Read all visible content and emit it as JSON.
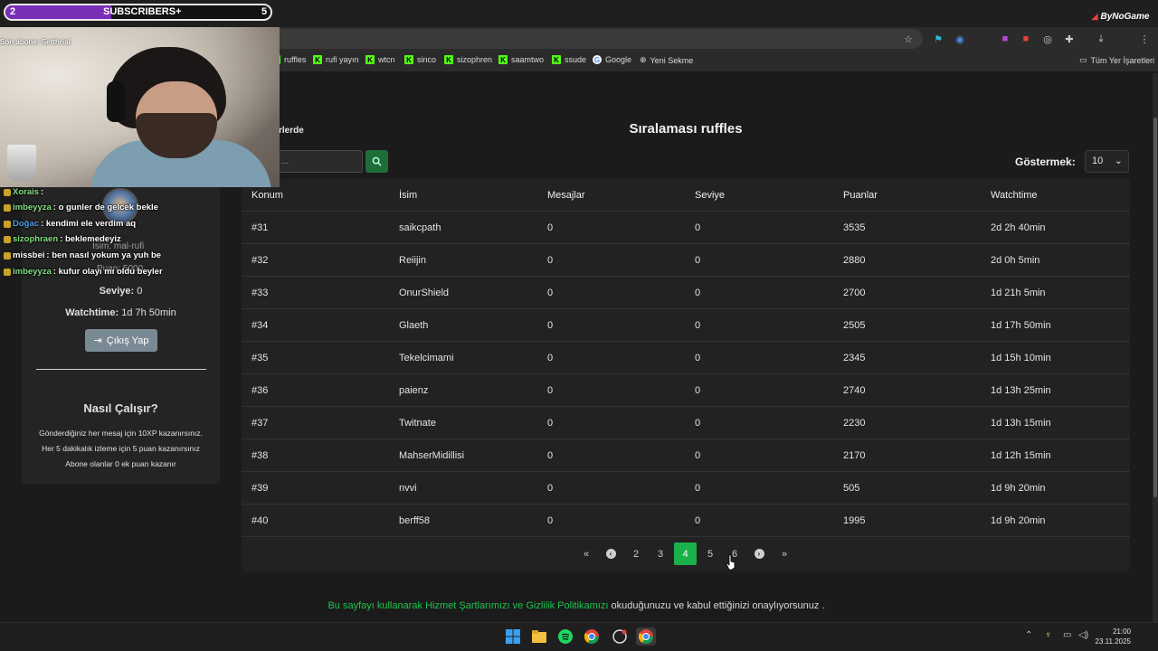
{
  "overlay": {
    "subscribers": {
      "current": "2",
      "label": "SUBSCRIBERS",
      "plus": "+",
      "goal": "5",
      "progress": 0.4
    },
    "last_sub": "Son abone: Setthrial",
    "chat": [
      {
        "user": "Xorais",
        "text": ":",
        "color": "#7fe07f"
      },
      {
        "user": "imbeyyza",
        "text": ": o gunler de gelcek bekle",
        "color": "#7fe07f"
      },
      {
        "user": "Doğac",
        "text": ": kendimi ele verdim aq",
        "color": "#4d9be6"
      },
      {
        "user": "sizophraen",
        "text": ": beklemedeyiz",
        "color": "#7fe07f"
      },
      {
        "user": "missbei",
        "text": ": ben nasıl yokum ya yuh be",
        "color": "#ffffff"
      },
      {
        "user": "imbeyyza",
        "text": ": kufur olayı mı oldu beyler",
        "color": "#7fe07f"
      }
    ],
    "channel_logo": "ByNoGame"
  },
  "browser": {
    "bookmarks": [
      {
        "label": "ruffles",
        "icon": "kick"
      },
      {
        "label": "rufi yayın",
        "icon": "kick"
      },
      {
        "label": "wtcn",
        "icon": "kick"
      },
      {
        "label": "sinco",
        "icon": "kick"
      },
      {
        "label": "sizophren",
        "icon": "kick"
      },
      {
        "label": "saamtwo",
        "icon": "kick"
      },
      {
        "label": "ssude",
        "icon": "kick"
      },
      {
        "label": "Google",
        "icon": "google"
      },
      {
        "label": "Yeni Sekme",
        "icon": "globe"
      }
    ],
    "all_bookmarks": "Tüm Yer İşaretleri"
  },
  "sidebar": {
    "name_label": "İsim: mal-rufi",
    "points_label": "Puan: 5000",
    "level_label": "Seviye:",
    "level_value": "0",
    "watchtime_label": "Watchtime:",
    "watchtime_value": "1d 7h 50min",
    "logout": "Çıkış Yap",
    "how_title": "Nasıl Çalışır?",
    "how_lines": [
      "Gönderdiğiniz her mesaj için 10XP kazanırsınız.",
      "Her 5 dakikalık izleme için 5 puan kazanırsınız",
      "Abone olanlar 0 ek puan kazanır"
    ],
    "partial_heading": "rlerde"
  },
  "main": {
    "title": "Sıralaması ruffles",
    "search_placeholder": "...",
    "show_label": "Göstermek:",
    "show_value": "10",
    "columns": [
      "Konum",
      "İsim",
      "Mesajlar",
      "Seviye",
      "Puanlar",
      "Watchtime"
    ],
    "rows": [
      [
        "#31",
        "saikcpath",
        "0",
        "0",
        "3535",
        "2d 2h 40min"
      ],
      [
        "#32",
        "Reiijin",
        "0",
        "0",
        "2880",
        "2d 0h 5min"
      ],
      [
        "#33",
        "OnurShield",
        "0",
        "0",
        "2700",
        "1d 21h 5min"
      ],
      [
        "#34",
        "Glaeth",
        "0",
        "0",
        "2505",
        "1d 17h 50min"
      ],
      [
        "#35",
        "Tekelcimami",
        "0",
        "0",
        "2345",
        "1d 15h 10min"
      ],
      [
        "#36",
        "paienz",
        "0",
        "0",
        "2740",
        "1d 13h 25min"
      ],
      [
        "#37",
        "Twitnate",
        "0",
        "0",
        "2230",
        "1d 13h 15min"
      ],
      [
        "#38",
        "MahserMidillisi",
        "0",
        "0",
        "2170",
        "1d 12h 15min"
      ],
      [
        "#39",
        "nvvi",
        "0",
        "0",
        "505",
        "1d 9h 20min"
      ],
      [
        "#40",
        "berff58",
        "0",
        "0",
        "1995",
        "1d 9h 20min"
      ]
    ],
    "pagination": {
      "first": "«",
      "prev": "‹",
      "pages": [
        "2",
        "3",
        "4",
        "5",
        "6"
      ],
      "current": "4",
      "next": "›",
      "last": "»"
    }
  },
  "footer": {
    "prefix": "Bu sayfayı kullanarak",
    "link1": "Hizmet Şartlarımızı",
    "middle": "ve",
    "link2": "Gizlilik Politikamızı",
    "suffix": "okuduğunuzu ve kabul ettiğinizi onaylıyorsunuz ."
  },
  "taskbar": {
    "time": "21:00",
    "date": "23.11.2025"
  },
  "colors": {
    "accent": "#1ab04a",
    "link": "#1ec24f",
    "subscribers_fill": "#7a2fb8"
  }
}
